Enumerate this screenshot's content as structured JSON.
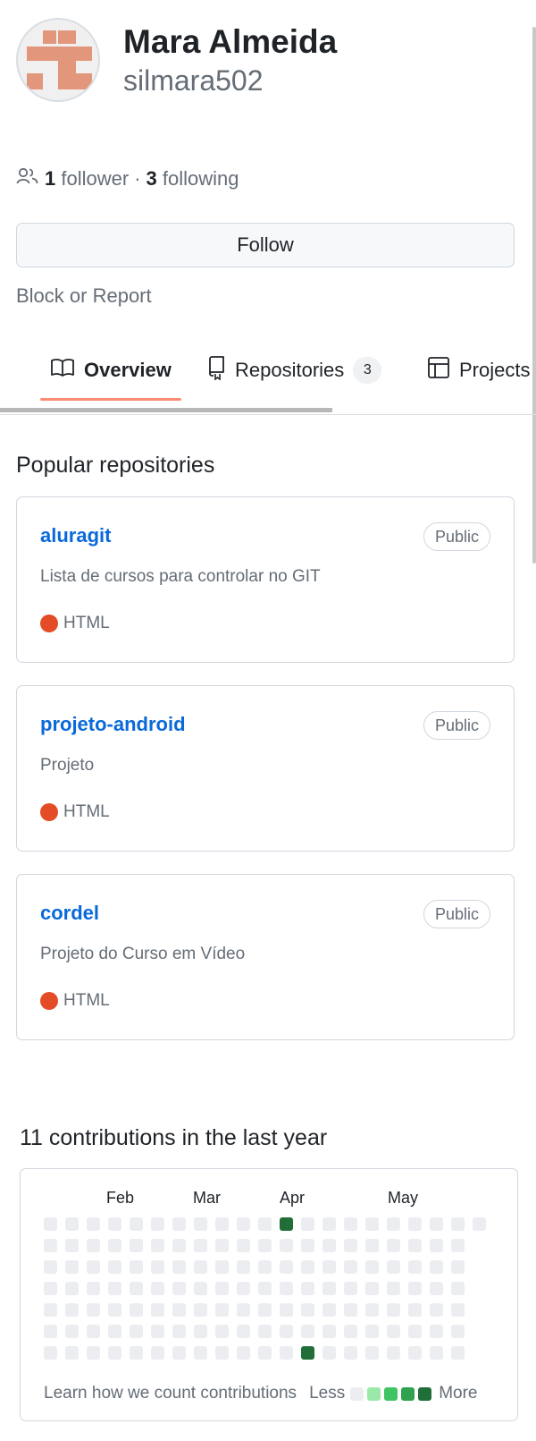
{
  "profile": {
    "name": "Mara Almeida",
    "login": "silmara502",
    "followers_count": "1",
    "followers_label": "follower",
    "separator": "·",
    "following_count": "3",
    "following_label": "following",
    "follow_button": "Follow",
    "block_report": "Block or Report",
    "avatar_color": "#e2967b"
  },
  "tabs": [
    {
      "label": "Overview",
      "icon": "book-icon",
      "active": true
    },
    {
      "label": "Repositories",
      "icon": "repo-icon",
      "counter": "3"
    },
    {
      "label": "Projects",
      "icon": "table-icon"
    }
  ],
  "popular": {
    "title": "Popular repositories",
    "repos": [
      {
        "name": "aluragit",
        "badge": "Public",
        "description": "Lista de cursos para controlar no GIT",
        "language": "HTML",
        "language_color": "#e34c26"
      },
      {
        "name": "projeto-android",
        "badge": "Public",
        "description": "Projeto",
        "language": "HTML",
        "language_color": "#e34c26"
      },
      {
        "name": "cordel",
        "badge": "Public",
        "description": "Projeto do Curso em Vídeo",
        "language": "HTML",
        "language_color": "#e34c26"
      }
    ]
  },
  "contributions": {
    "title": "11 contributions in the last year",
    "months": [
      "Feb",
      "Mar",
      "Apr",
      "May"
    ],
    "weeks": 21,
    "days_per_week": 7,
    "last_week_days": 1,
    "active_cells": [
      {
        "week": 11,
        "day": 0,
        "level": 4
      },
      {
        "week": 12,
        "day": 6,
        "level": 4
      }
    ],
    "level_colors": [
      "#ebedf0",
      "#9be9a8",
      "#40c463",
      "#30a14e",
      "#216e39"
    ],
    "learn_link": "Learn how we count contributions",
    "less_label": "Less",
    "more_label": "More"
  }
}
